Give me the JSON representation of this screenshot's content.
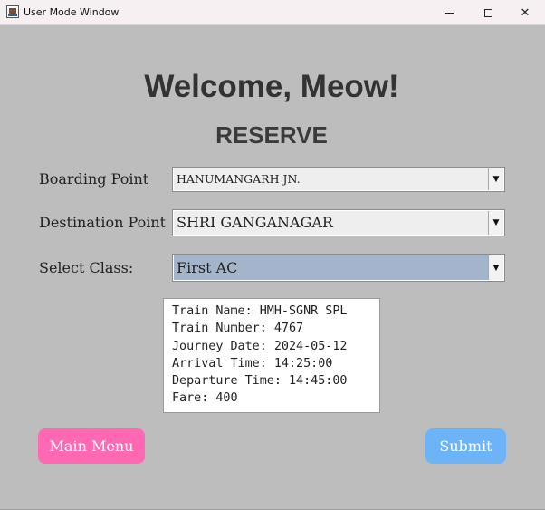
{
  "window": {
    "title": "User Mode Window",
    "min_glyph": "",
    "max_glyph": "",
    "close_glyph": "✕"
  },
  "header": {
    "welcome": "Welcome, Meow!",
    "subtitle": "RESERVE"
  },
  "form": {
    "boarding_label": "Boarding Point",
    "boarding_value": "HANUMANGARH JN.",
    "destination_label": "Destination Point",
    "destination_value": "SHRI GANGANAGAR",
    "class_label": "Select Class:",
    "class_value": "First AC",
    "dropdown_arrow": "▼"
  },
  "train_info": {
    "lines": [
      "Train Name: HMH-SGNR SPL",
      "Train Number: 4767",
      "Journey Date: 2024-05-12",
      "Arrival Time: 14:25:00",
      "Departure Time: 14:45:00",
      "Fare: 400"
    ]
  },
  "buttons": {
    "main_menu": "Main Menu",
    "submit": "Submit"
  },
  "colors": {
    "background": "#bdbdbd",
    "main_menu_button": "#ff69b4",
    "submit_button": "#6db3f8",
    "selected_combo": "#a3b4cb"
  }
}
